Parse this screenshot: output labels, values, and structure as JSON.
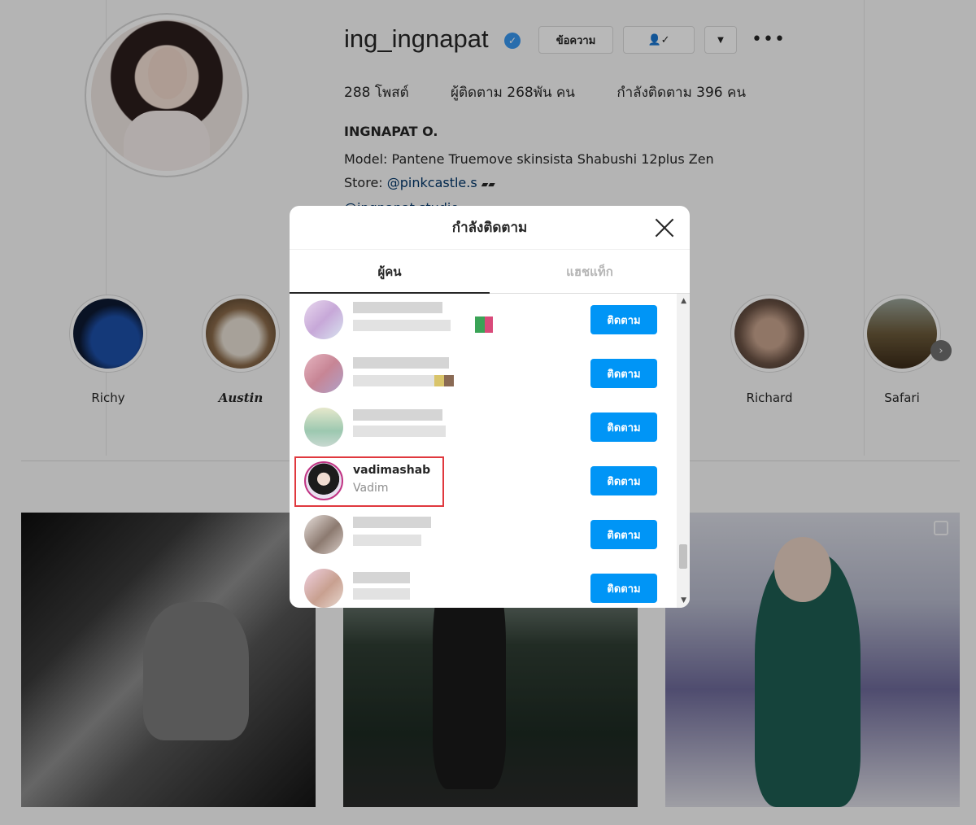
{
  "profile": {
    "username": "ing_ingnapat",
    "actions": {
      "message_label": "ข้อความ",
      "following_icon": "user-check-icon",
      "dropdown_icon": "chevron-down-icon",
      "more_icon": "more-dots-icon"
    },
    "stats": {
      "posts": "288 โพสต์",
      "followers": "ผู้ติดตาม 268พัน คน",
      "following": "กำลังติดตาม 396 คน"
    },
    "full_name": "INGNAPAT O.",
    "bio_line1": "Model: Pantene Truemove skinsista Shabushi 12plus Zen",
    "bio_store_prefix": "Store: ",
    "bio_store_link": "@pinkcastle.s",
    "bio_line3": "@ingnapat.studio"
  },
  "highlights": [
    {
      "label": "Richy"
    },
    {
      "label": "Austin"
    },
    {
      "label": "Richard"
    },
    {
      "label": "Safari"
    }
  ],
  "modal": {
    "title": "กำลังติดตาม",
    "tabs": [
      {
        "label": "ผู้คน"
      },
      {
        "label": "แฮชแท็ก"
      }
    ],
    "follow_label": "ติดตาม",
    "highlighted_user": {
      "username": "vadimashab",
      "display_name": "Vadim"
    }
  },
  "colors": {
    "accent": "#0095f6",
    "highlight_box": "#e0383e",
    "verified": "#3897f0"
  }
}
